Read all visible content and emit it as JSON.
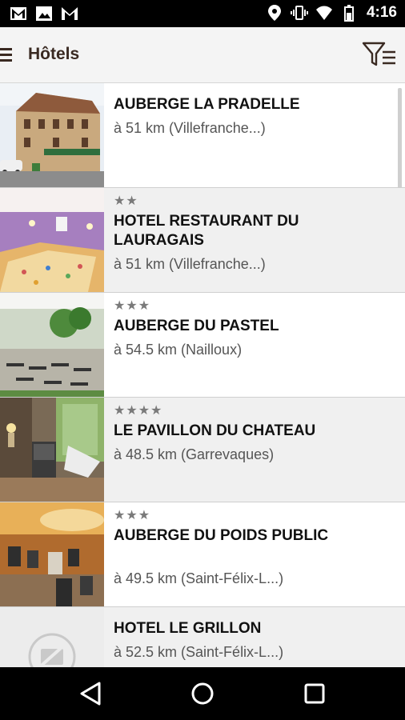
{
  "status_bar": {
    "time": "4:16",
    "left_icons": [
      "gmail-icon",
      "image-icon",
      "gmail-icon"
    ],
    "right_icons": [
      "location-icon",
      "vibrate-icon",
      "wifi-icon",
      "battery-icon"
    ]
  },
  "app_bar": {
    "title": "Hôtels",
    "menu_icon": "menu-icon",
    "filter_icon": "filter-icon"
  },
  "hotels": [
    {
      "name": "AUBERGE LA PRADELLE",
      "stars": "",
      "distance": "à 51 km (Villefranche...)"
    },
    {
      "name": "HOTEL RESTAURANT DU LAURAGAIS",
      "stars": "★★",
      "distance": "à 51 km (Villefranche...)"
    },
    {
      "name": "AUBERGE DU PASTEL",
      "stars": "★★★",
      "distance": "à 54.5 km (Nailloux)"
    },
    {
      "name": "LE PAVILLON DU CHATEAU",
      "stars": "★★★★",
      "distance": "à 48.5 km (Garrevaques)"
    },
    {
      "name": "AUBERGE DU POIDS PUBLIC",
      "stars": "★★★",
      "distance": "à 49.5 km (Saint-Félix-L...)"
    },
    {
      "name": "HOTEL LE GRILLON",
      "stars": "",
      "distance": "à 52.5 km (Saint-Félix-L...)"
    }
  ],
  "colors": {
    "app_bar_bg": "#f4f4f4",
    "title_color": "#3a2a22",
    "row_alt_bg": "#f0f0f0",
    "star_color": "#7a7a7a"
  },
  "nav_bar": {
    "buttons": [
      "back-icon",
      "home-icon",
      "recents-icon"
    ]
  }
}
